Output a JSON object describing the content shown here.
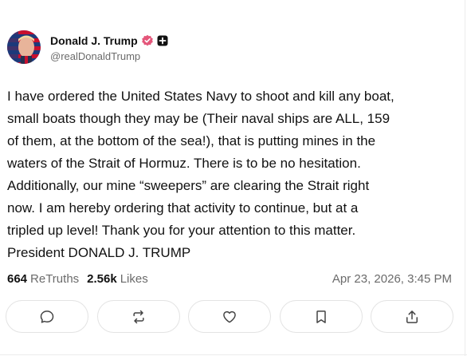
{
  "author": {
    "display_name": "Donald J. Trump",
    "handle": "@realDonaldTrump"
  },
  "post": {
    "text": "I have ordered the United States Navy to shoot and kill any boat,\nsmall boats though they may be (Their naval ships are ALL, 159\nof them, at the bottom of the sea!), that is putting mines in the\nwaters of the Strait of Hormuz. There is to be no hesitation.\nAdditionally, our mine “sweepers” are clearing the Strait right\nnow. I am hereby ordering that activity to continue, but at a\ntripled up level! Thank you for your attention to this matter.\nPresident DONALD J. TRUMP",
    "retruths_count": "664",
    "retruths_label": "ReTruths",
    "likes_count": "2.56k",
    "likes_label": "Likes",
    "timestamp": "Apr 23, 2026, 3:45 PM"
  },
  "actions": {
    "reply_icon": "speech-bubble-icon",
    "retruth_icon": "repost-arrows-icon",
    "like_icon": "heart-icon",
    "bookmark_icon": "bookmark-icon",
    "share_icon": "share-upload-icon"
  },
  "colors": {
    "verified": "#e4567a",
    "secondary_text": "#6b6b6b",
    "border": "#e3e3e3"
  }
}
